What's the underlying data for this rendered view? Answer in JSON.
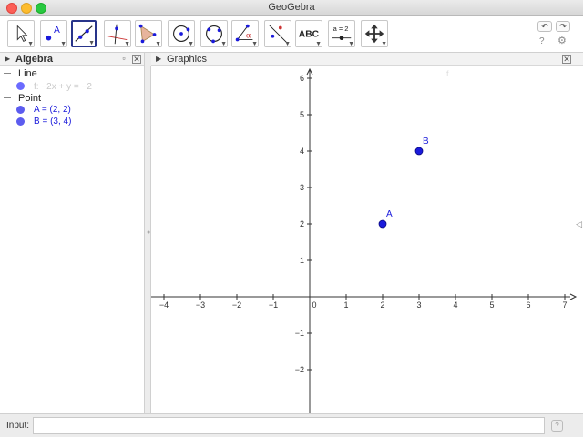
{
  "window": {
    "title": "GeoGebra"
  },
  "toolbar": {
    "tools": [
      {
        "name": "move-tool",
        "icon": "cursor-arrow-icon"
      },
      {
        "name": "point-tool",
        "icon": "point-icon",
        "label": "A"
      },
      {
        "name": "line-tool",
        "icon": "line-through-two-points-icon",
        "active": true
      },
      {
        "name": "perpendicular-line-tool",
        "icon": "perpendicular-line-icon"
      },
      {
        "name": "polygon-tool",
        "icon": "polygon-icon"
      },
      {
        "name": "circle-center-point-tool",
        "icon": "circle-center-icon"
      },
      {
        "name": "circle-three-points-tool",
        "icon": "circle-three-points-icon"
      },
      {
        "name": "angle-tool",
        "icon": "angle-icon",
        "label": "α"
      },
      {
        "name": "reflect-tool",
        "icon": "reflect-about-line-icon"
      },
      {
        "name": "text-tool",
        "icon": "text-icon",
        "label": "ABC"
      },
      {
        "name": "slider-tool",
        "icon": "slider-icon",
        "label": "a = 2"
      },
      {
        "name": "move-graphics-view-tool",
        "icon": "move-graphics-view-icon"
      }
    ],
    "undo_label": "↶",
    "redo_label": "↷",
    "help_label": "?",
    "settings_label": "⚙"
  },
  "algebra": {
    "title": "Algebra",
    "groups": [
      {
        "label": "Line",
        "items": [
          {
            "text": "f: −2x + y = −2",
            "color": "#6b6bff",
            "faded": true
          }
        ]
      },
      {
        "label": "Point",
        "items": [
          {
            "text": "A = (2, 2)",
            "color": "#5c5cef"
          },
          {
            "text": "B = (3, 4)",
            "color": "#5c5cef"
          }
        ]
      }
    ]
  },
  "graphics": {
    "title": "Graphics",
    "x_ticks": [
      "−4",
      "−3",
      "−2",
      "−1",
      "0",
      "1",
      "2",
      "3",
      "4",
      "5",
      "6",
      "7"
    ],
    "y_ticks": [
      "6",
      "5",
      "4",
      "3",
      "2",
      "1",
      "0",
      "−1",
      "−2"
    ],
    "points": [
      {
        "label": "A",
        "x": 2,
        "y": 2
      },
      {
        "label": "B",
        "x": 3,
        "y": 4
      }
    ],
    "line_label": "f",
    "point_color": "#1a1adb"
  },
  "input": {
    "label": "Input:",
    "value": "",
    "help_label": "?"
  }
}
